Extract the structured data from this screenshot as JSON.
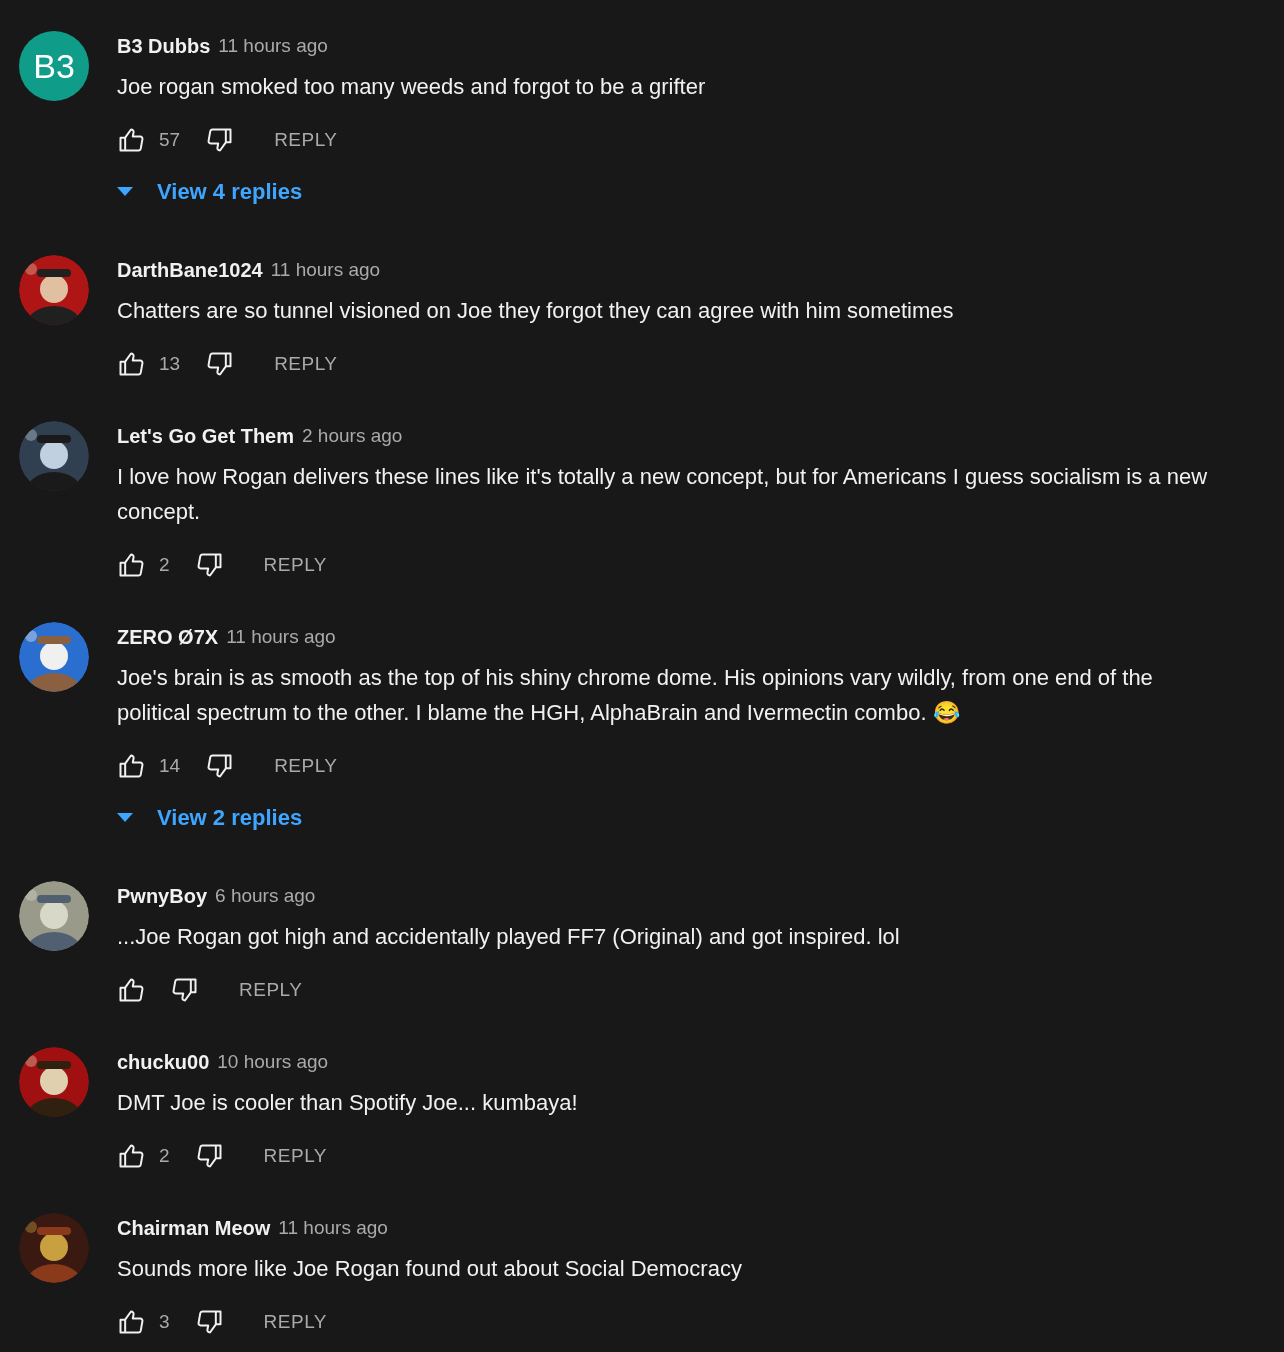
{
  "comments": [
    {
      "avatar": {
        "kind": "letters",
        "text": "B3",
        "color": "#0f9d8a"
      },
      "author": "B3 Dubbs",
      "time": "11 hours ago",
      "text": "Joe rogan smoked too many weeds and forgot to be a grifter",
      "likes": "57",
      "reply": "REPLY",
      "replies": "View 4 replies"
    },
    {
      "author": "DarthBane1024",
      "time": "11 hours ago",
      "text": "Chatters are so tunnel visioned on Joe they forgot they can agree with him sometimes",
      "likes": "13",
      "reply": "REPLY"
    },
    {
      "author": "Let's Go Get Them",
      "time": "2 hours ago",
      "text": "I love how Rogan delivers these lines like it's totally a new concept, but for Americans I guess socialism is a new concept.",
      "likes": "2",
      "reply": "REPLY"
    },
    {
      "author": "ZERO Ø7X",
      "time": "11 hours ago",
      "text": "Joe's brain is as smooth as the top of his shiny chrome dome.  His opinions vary wildly, from one end of the political spectrum to the other. I blame the HGH, AlphaBrain and Ivermectin combo. 😂",
      "likes": "14",
      "reply": "REPLY",
      "replies": "View 2 replies"
    },
    {
      "author": "PwnyBoy",
      "time": "6 hours ago",
      "text": "...Joe Rogan got high and accidentally played FF7 (Original) and got inspired. lol",
      "reply": "REPLY"
    },
    {
      "author": "chucku00",
      "time": "10 hours ago",
      "text": "DMT Joe is cooler than Spotify Joe... kumbaya!",
      "likes": "2",
      "reply": "REPLY"
    },
    {
      "author": "Chairman Meow",
      "time": "11 hours ago",
      "text": "Sounds more like Joe Rogan found out about Social Democracy",
      "likes": "3",
      "reply": "REPLY"
    }
  ]
}
